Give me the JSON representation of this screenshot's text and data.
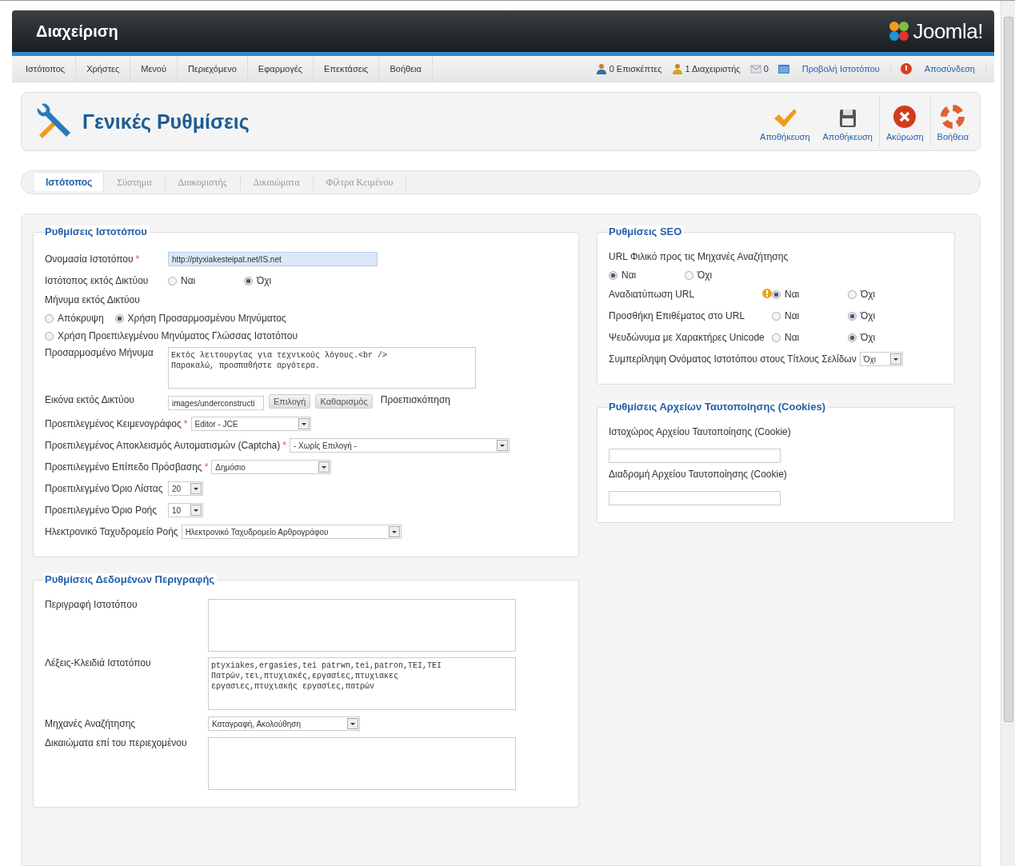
{
  "header": {
    "title": "Διαχείριση",
    "logo": "Joomla!"
  },
  "menu": [
    "Ιστότοπος",
    "Χρήστες",
    "Μενού",
    "Περιεχόμενο",
    "Εφαρμογές",
    "Επεκτάσεις",
    "Βοήθεια"
  ],
  "status": [
    {
      "kind": "visitors",
      "text": "0 Επισκέπτες"
    },
    {
      "kind": "admins",
      "text": "1 Διαχειριστής"
    },
    {
      "kind": "messages",
      "text": "0"
    },
    {
      "kind": "view-site",
      "text": "Προβολή Ιστοτόπου"
    },
    {
      "kind": "logout",
      "text": "Αποσύνδεση"
    }
  ],
  "toolbar": {
    "title": "Γενικές Ρυθμίσεις",
    "buttons": [
      {
        "kind": "save-close",
        "label": "Αποθήκευση"
      },
      {
        "kind": "save",
        "label": "Αποθήκευση"
      },
      {
        "kind": "cancel",
        "label": "Ακύρωση"
      },
      {
        "kind": "help",
        "label": "Βοήθεια"
      }
    ]
  },
  "tabs": [
    {
      "label": "Ιστότοπος",
      "selected": true
    },
    {
      "label": "Σύστημα",
      "selected": false
    },
    {
      "label": "Διακομιστής",
      "selected": false
    },
    {
      "label": "Δικαιώματα",
      "selected": false
    },
    {
      "label": "Φίλτρα Κειμένου",
      "selected": false
    }
  ],
  "left_fieldsets": [
    {
      "legend": "Ρυθμίσεις Ιστοτόπου",
      "fields": [
        {
          "kind": "text",
          "label": "Ονομασία Ιστοτόπου",
          "marker": "*",
          "value": "http://ptyxiakesteipat.net/IS.net",
          "highlighted": true
        },
        {
          "kind": "radio",
          "label": "Ιστότοπος εκτός Δικτύου",
          "options": [
            {
              "label": "Ναι",
              "selected": false
            },
            {
              "label": "Όχι",
              "selected": true
            }
          ]
        },
        {
          "kind": "radio-block",
          "label": "Μήνυμα εκτός Δικτύου",
          "options": [
            {
              "label": "Απόκρυψη",
              "selected": false
            },
            {
              "label": "Χρήση Προσαρμοσμένου Μηνύματος",
              "selected": true
            },
            {
              "label": "Χρήση Προεπιλεγμένου Μηνύματος Γλώσσας Ιστοτόπου",
              "selected": false
            }
          ]
        },
        {
          "kind": "textarea",
          "label": "Προσαρμοσμένο Μήνυμα",
          "lines": [
            "Εκτός λειτουργίας για τεχνικούς λόγους.<br />",
            "Παρακαλώ, προσπαθήστε αργότερα."
          ]
        },
        {
          "kind": "image",
          "label": "Εικόνα εκτός Δικτύου",
          "value": "images/underconstructi",
          "buttons": [
            "Επιλογή",
            "Καθαρισμός"
          ],
          "preview": "Προεπισκόπηση"
        },
        {
          "kind": "select",
          "label": "Προεπιλεγμένος Κειμενογράφος",
          "marker": "*",
          "value": "Editor - JCE"
        },
        {
          "kind": "select",
          "label": "Προεπιλεγμένος Αποκλεισμός Αυτοματισμών (Captcha)",
          "marker": "*",
          "value": "- Χωρίς Επιλογή -"
        },
        {
          "kind": "select",
          "label": "Προεπιλεγμένο Επίπεδο Πρόσβασης",
          "marker": "*",
          "value": "Δημόσιο"
        },
        {
          "kind": "select",
          "label": "Προεπιλεγμένο Όριο Λίστας",
          "value": "20"
        },
        {
          "kind": "select",
          "label": "Προεπιλεγμένο Όριο Ροής",
          "value": "10"
        },
        {
          "kind": "select",
          "label": "Ηλεκτρονικό Ταχυδρομείο Ροής",
          "value": "Ηλεκτρονικό Ταχυδρομείο Αρθρογράφου"
        }
      ]
    },
    {
      "legend": "Ρυθμίσεις Δεδομένων Περιγραφής",
      "fields": [
        {
          "kind": "textarea",
          "label": "Περιγραφή Ιστοτόπου"
        },
        {
          "kind": "textarea",
          "label": "Λέξεις-Κλειδιά Ιστοτόπου",
          "lines": [
            "ptyxiakes,ergasies,tei patrwn,tei,patron,ΤΕΙ,ΤΕΙ",
            "Πατρών,τει,πτυχιακές,εργασίες,πτυχιακες",
            "εργασιες,πτυχιακής εργασίες,πατρών"
          ]
        },
        {
          "kind": "select",
          "label": "Μηχανές Αναζήτησης",
          "value": "Καταγραφή, Ακολούθηση"
        },
        {
          "kind": "textarea",
          "label": "Δικαιώματα επί του περιεχομένου"
        }
      ]
    }
  ],
  "right_fieldsets": [
    {
      "legend": "Ρυθμίσεις SEO",
      "fields": [
        {
          "kind": "radio-block",
          "label": "URL Φιλικό προς τις Μηχανές Αναζήτησης",
          "options": [
            {
              "label": "Ναι",
              "selected": true
            },
            {
              "label": "Όχι",
              "selected": false
            }
          ]
        },
        {
          "kind": "radio",
          "label": "Αναδιατύπωση URL",
          "warning": true,
          "options": [
            {
              "label": "Ναι",
              "selected": true
            },
            {
              "label": "Όχι",
              "selected": false
            }
          ]
        },
        {
          "kind": "radio",
          "label": "Προσθήκη Επιθέματος στο URL",
          "options": [
            {
              "label": "Ναι",
              "selected": false
            },
            {
              "label": "Όχι",
              "selected": true
            }
          ]
        },
        {
          "kind": "radio",
          "label": "Ψευδώνυμα με Χαρακτήρες Unicode",
          "options": [
            {
              "label": "Ναι",
              "selected": false
            },
            {
              "label": "Όχι",
              "selected": true
            }
          ]
        },
        {
          "kind": "select",
          "label": "Συμπερίληψη Ονόματος Ιστοτόπου στους Τίτλους Σελίδων",
          "value": "Όχι"
        }
      ]
    },
    {
      "legend": "Ρυθμίσεις Αρχείων Ταυτοποίησης (Cookies)",
      "fields": [
        {
          "kind": "text-block",
          "label": "Ιστοχώρος Αρχείου Ταυτοποίησης (Cookie)"
        },
        {
          "kind": "text-block",
          "label": "Διαδρομή Αρχείου Ταυτοποίησης (Cookie)"
        }
      ]
    }
  ]
}
